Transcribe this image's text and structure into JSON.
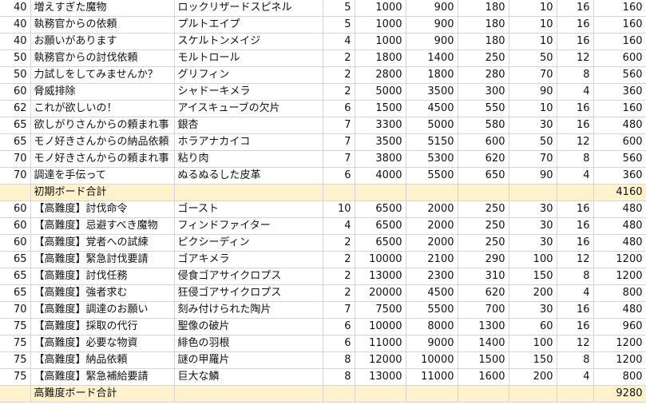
{
  "sheet": {
    "rows": [
      {
        "type": "data",
        "cells": [
          "40",
          "増えすぎた魔物",
          "ロックリザードスピネル",
          "5",
          "1000",
          "900",
          "180",
          "10",
          "16",
          "160"
        ]
      },
      {
        "type": "data",
        "cells": [
          "40",
          "執務官からの依頼",
          "プルトエイプ",
          "5",
          "1000",
          "900",
          "180",
          "10",
          "16",
          "160"
        ]
      },
      {
        "type": "data",
        "cells": [
          "40",
          "お願いがあります",
          "スケルトンメイジ",
          "4",
          "1000",
          "900",
          "180",
          "10",
          "16",
          "160"
        ]
      },
      {
        "type": "data",
        "cells": [
          "50",
          "執務官からの討伐依頼",
          "モルトロール",
          "2",
          "1800",
          "1400",
          "250",
          "50",
          "12",
          "600"
        ]
      },
      {
        "type": "data",
        "cells": [
          "50",
          "力試しをしてみませんか？",
          "グリフィン",
          "2",
          "2800",
          "1800",
          "280",
          "70",
          "8",
          "560"
        ]
      },
      {
        "type": "data",
        "cells": [
          "60",
          "脅威排除",
          "シャドーキメラ",
          "2",
          "5000",
          "3500",
          "300",
          "90",
          "4",
          "360"
        ]
      },
      {
        "type": "data",
        "cells": [
          "62",
          "これが欲しいの！",
          "アイスキューブの欠片",
          "6",
          "1500",
          "4500",
          "550",
          "10",
          "16",
          "160"
        ]
      },
      {
        "type": "data",
        "cells": [
          "65",
          "欲しがりさんからの頼まれ事",
          "銀杏",
          "7",
          "3300",
          "5000",
          "580",
          "30",
          "16",
          "480"
        ]
      },
      {
        "type": "data",
        "cells": [
          "65",
          "モノ好きさんからの納品依頼",
          "ホラアナカイコ",
          "7",
          "3500",
          "5150",
          "600",
          "50",
          "12",
          "600"
        ]
      },
      {
        "type": "data",
        "cells": [
          "70",
          "モノ好きさんからの頼まれ事",
          "粘り肉",
          "7",
          "3800",
          "5300",
          "620",
          "70",
          "8",
          "560"
        ]
      },
      {
        "type": "data",
        "cells": [
          "70",
          "調達を手伝って",
          "ぬるぬるした皮革",
          "6",
          "4000",
          "5500",
          "650",
          "90",
          "4",
          "360"
        ]
      },
      {
        "type": "total",
        "label": "初期ボード合計",
        "total": "4160"
      },
      {
        "type": "data",
        "cells": [
          "60",
          "【高難度】討伐命令",
          "ゴースト",
          "10",
          "6500",
          "2000",
          "250",
          "30",
          "16",
          "480"
        ]
      },
      {
        "type": "data",
        "cells": [
          "60",
          "【高難度】忌避すべき魔物",
          "フィンドファイター",
          "4",
          "6500",
          "2000",
          "250",
          "30",
          "16",
          "480"
        ]
      },
      {
        "type": "data",
        "cells": [
          "60",
          "【高難度】覚者への試練",
          "ピクシーディン",
          "2",
          "6500",
          "2000",
          "250",
          "30",
          "16",
          "480"
        ]
      },
      {
        "type": "data",
        "cells": [
          "65",
          "【高難度】緊急討伐要請",
          "ゴアキメラ",
          "2",
          "10000",
          "2100",
          "290",
          "100",
          "12",
          "1200"
        ]
      },
      {
        "type": "data",
        "cells": [
          "65",
          "【高難度】討伐任務",
          "侵食ゴアサイクロプス",
          "2",
          "13000",
          "2300",
          "310",
          "150",
          "8",
          "1200"
        ]
      },
      {
        "type": "data",
        "cells": [
          "65",
          "【高難度】強者求む",
          "狂侵ゴアサイクロプス",
          "2",
          "20000",
          "4500",
          "620",
          "200",
          "4",
          "800"
        ]
      },
      {
        "type": "data",
        "cells": [
          "70",
          "【高難度】調達のお願い",
          "刻み付けられた陶片",
          "7",
          "7500",
          "5500",
          "700",
          "30",
          "16",
          "480"
        ]
      },
      {
        "type": "data",
        "cells": [
          "75",
          "【高難度】採取の代行",
          "聖像の破片",
          "6",
          "10000",
          "8000",
          "1300",
          "60",
          "16",
          "960"
        ]
      },
      {
        "type": "data",
        "cells": [
          "75",
          "【高難度】必要な物資",
          "緋色の羽根",
          "6",
          "11000",
          "9000",
          "1400",
          "100",
          "12",
          "1200"
        ]
      },
      {
        "type": "data",
        "cells": [
          "75",
          "【高難度】納品依頼",
          "謎の甲羅片",
          "8",
          "12000",
          "10000",
          "1500",
          "150",
          "8",
          "1200"
        ]
      },
      {
        "type": "data",
        "cells": [
          "75",
          "【高難度】緊急補給要請",
          "巨大な鱗",
          "8",
          "13000",
          "11000",
          "1600",
          "200",
          "4",
          "800"
        ]
      },
      {
        "type": "total",
        "label": "高難度ボード合計",
        "total": "9280"
      }
    ]
  }
}
